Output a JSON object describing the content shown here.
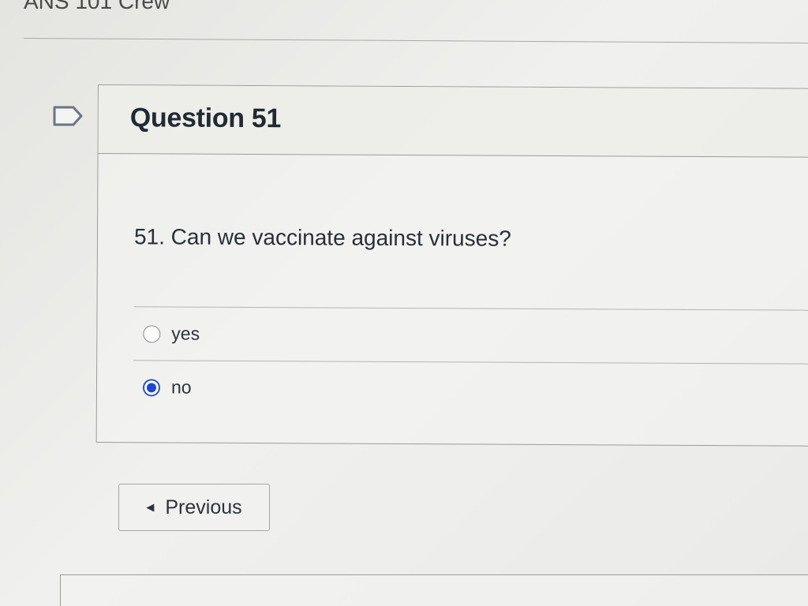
{
  "course_header": "ANS 101 Crew",
  "question": {
    "title": "Question 51",
    "number": "51.",
    "text": "Can we vaccinate against viruses?",
    "answers": [
      {
        "label": "yes",
        "selected": false
      },
      {
        "label": "no",
        "selected": true
      }
    ]
  },
  "navigation": {
    "previous_label": "Previous"
  },
  "colors": {
    "selected_radio": "#1e47d6",
    "text": "#2b343b"
  }
}
